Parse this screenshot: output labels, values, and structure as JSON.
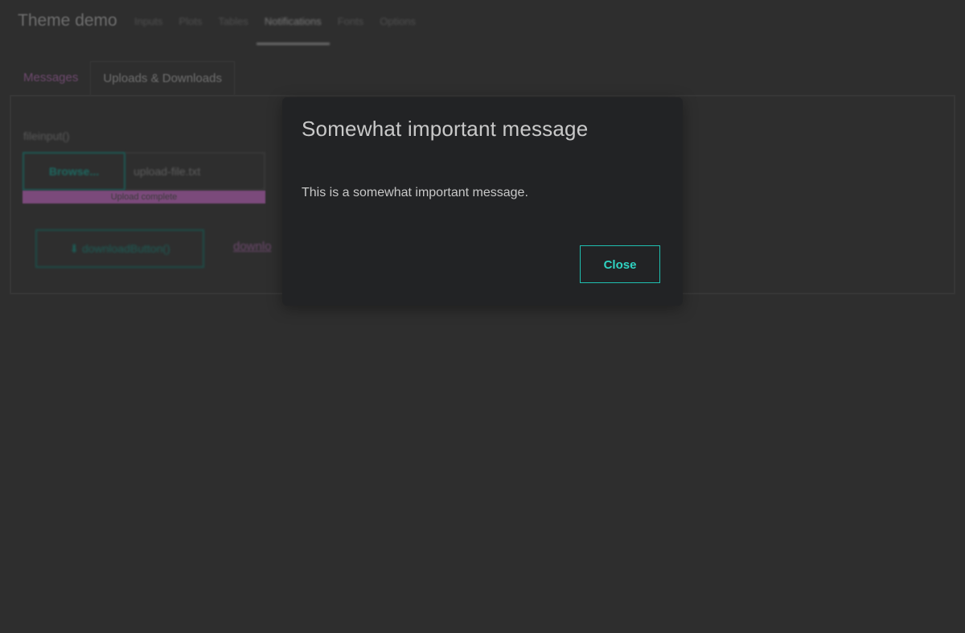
{
  "navbar": {
    "brand": "Theme demo",
    "items": [
      {
        "label": "Inputs"
      },
      {
        "label": "Plots"
      },
      {
        "label": "Tables"
      },
      {
        "label": "Notifications"
      },
      {
        "label": "Fonts"
      },
      {
        "label": "Options"
      }
    ],
    "active_index": 3
  },
  "tabs": {
    "items": [
      {
        "label": "Messages"
      },
      {
        "label": "Uploads & Downloads"
      }
    ],
    "active_index": 1
  },
  "uploads": {
    "file_input_label": "fileinput()",
    "browse_label": "Browse...",
    "file_name": "upload-file.txt",
    "progress_text": "Upload complete",
    "progress_value": 1.0,
    "download_button_label": "downloadButton()",
    "download_link_label": "downlo"
  },
  "modal": {
    "title": "Somewhat important message",
    "body": "This is a somewhat important message.",
    "close_label": "Close"
  },
  "colors": {
    "accent_teal": "#1fbfb0",
    "accent_magenta": "#b36ab3",
    "modal_bg": "#222325",
    "page_bg": "#2e2e2e"
  },
  "icons": {
    "download": "download-icon"
  }
}
